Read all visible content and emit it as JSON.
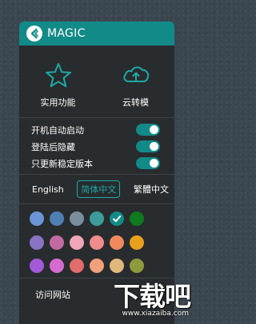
{
  "header": {
    "title": "MAGIC",
    "logo_icon": "magic-logo-icon",
    "color": "#128a88"
  },
  "features": [
    {
      "label": "实用功能",
      "icon": "star-icon"
    },
    {
      "label": "云转模",
      "icon": "cloud-upload-icon"
    }
  ],
  "toggles": [
    {
      "label": "开机自动启动",
      "on": true
    },
    {
      "label": "登陆后隐藏",
      "on": true
    },
    {
      "label": "只更新稳定版本",
      "on": true
    }
  ],
  "languages": [
    {
      "label": "English",
      "selected": false
    },
    {
      "label": "简体中文",
      "selected": true
    },
    {
      "label": "繁體中文",
      "selected": false
    }
  ],
  "theme_colors": [
    "#6a95d6",
    "#4f7fb3",
    "#7a8e9d",
    "#3d9c9a",
    "#138a88",
    "#0f7a1e",
    "#8a73c2",
    "#c46aa3",
    "#f0a6b8",
    "#f08c8c",
    "#f08a5c",
    "#e8a01c",
    "#a25ad6",
    "#d56bd0",
    "#e06c6c",
    "#f0a07a",
    "#e0b87c",
    "#8f9a3c"
  ],
  "selected_color_index": 4,
  "footer": {
    "link": "访问网站"
  },
  "watermark": {
    "main": "下载吧",
    "sub": "www.xiazaiba.com"
  }
}
